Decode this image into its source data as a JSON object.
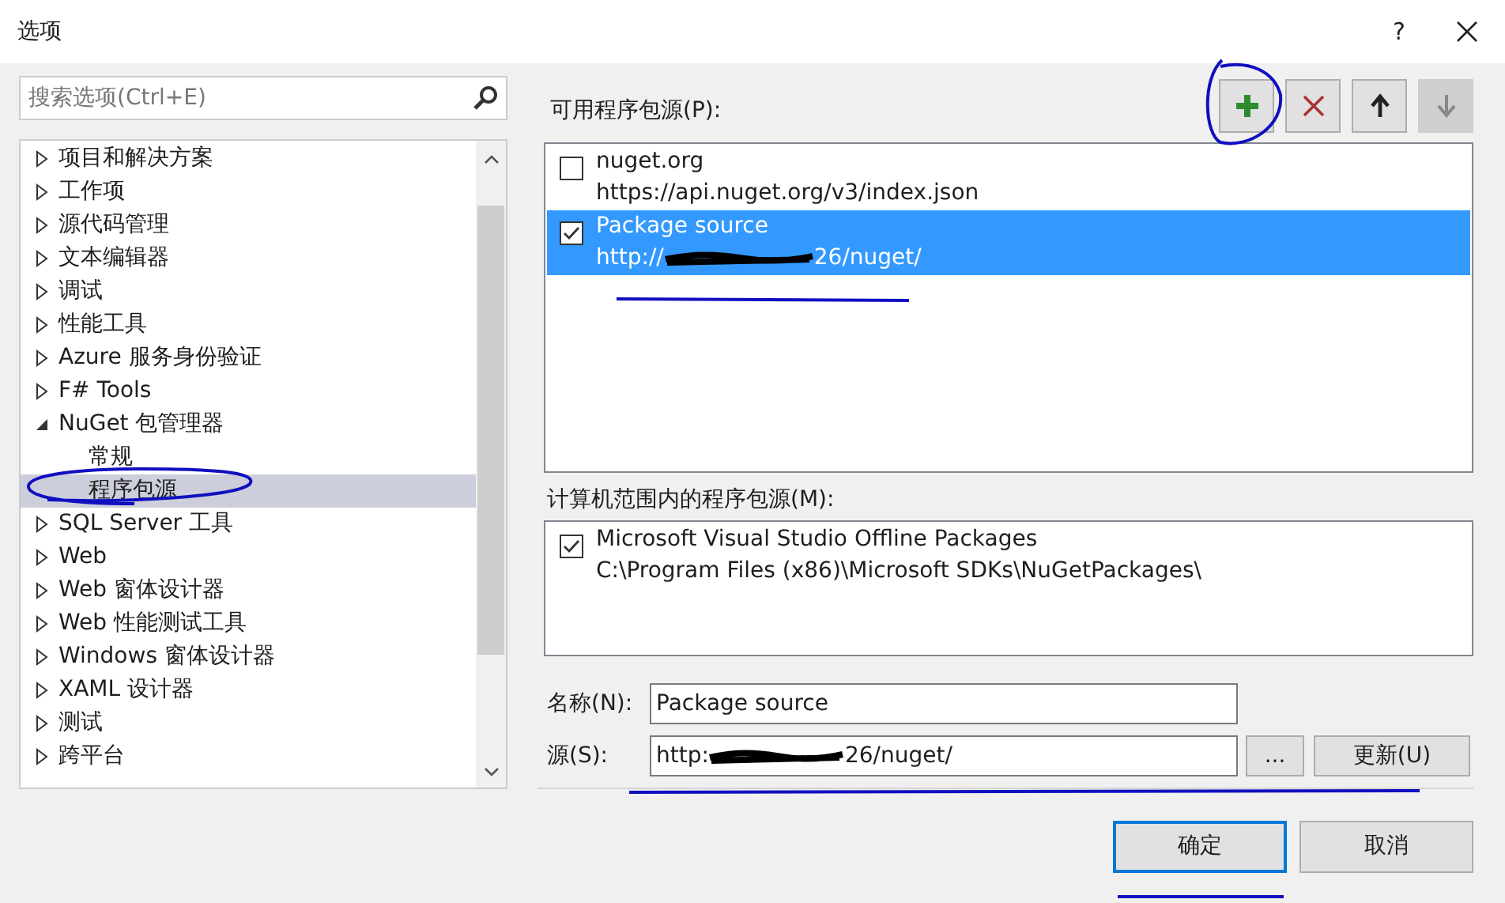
{
  "window": {
    "title": "选项",
    "help": "?"
  },
  "search": {
    "placeholder": "搜索选项(Ctrl+E)"
  },
  "tree": [
    {
      "label": "项目和解决方案",
      "expanded": false
    },
    {
      "label": "工作项",
      "expanded": false
    },
    {
      "label": "源代码管理",
      "expanded": false
    },
    {
      "label": "文本编辑器",
      "expanded": false
    },
    {
      "label": "调试",
      "expanded": false
    },
    {
      "label": "性能工具",
      "expanded": false
    },
    {
      "label": "Azure 服务身份验证",
      "expanded": false
    },
    {
      "label": "F# Tools",
      "expanded": false
    },
    {
      "label": "NuGet 包管理器",
      "expanded": true,
      "children": [
        {
          "label": "常规",
          "selected": false
        },
        {
          "label": "程序包源",
          "selected": true
        }
      ]
    },
    {
      "label": "SQL Server 工具",
      "expanded": false
    },
    {
      "label": "Web",
      "expanded": false
    },
    {
      "label": "Web 窗体设计器",
      "expanded": false
    },
    {
      "label": "Web 性能测试工具",
      "expanded": false
    },
    {
      "label": "Windows 窗体设计器",
      "expanded": false
    },
    {
      "label": "XAML 设计器",
      "expanded": false
    },
    {
      "label": "测试",
      "expanded": false
    },
    {
      "label": "跨平台",
      "expanded": false
    }
  ],
  "available_sources": {
    "label": "可用程序包源(P):",
    "toolbar": [
      {
        "kind": "add",
        "disabled": false
      },
      {
        "kind": "remove",
        "disabled": false
      },
      {
        "kind": "up",
        "disabled": false
      },
      {
        "kind": "down",
        "disabled": true
      }
    ],
    "items": [
      {
        "name": "nuget.org",
        "url_start": "https://api.nuget.org/v3/index.json",
        "checked": false,
        "selected": false
      },
      {
        "name": "Package source",
        "url_start": "http://",
        "url_end": "26/nuget/",
        "checked": true,
        "selected": true
      }
    ]
  },
  "machine_sources": {
    "label": "计算机范围内的程序包源(M):",
    "items": [
      {
        "name": "Microsoft Visual Studio Offline Packages",
        "url_start": "C:\\Program Files (x86)\\Microsoft SDKs\\NuGetPackages\\",
        "checked": true,
        "selected": false
      }
    ]
  },
  "name_field": {
    "label": "名称(N):",
    "value": "Package source"
  },
  "source_field": {
    "label": "源(S):",
    "value_start": "http:",
    "value_end": "26/nuget/",
    "browse": "...",
    "update": "更新(U)"
  },
  "buttons": [
    {
      "label": "确定",
      "default": true
    },
    {
      "label": "取消",
      "default": false
    }
  ]
}
